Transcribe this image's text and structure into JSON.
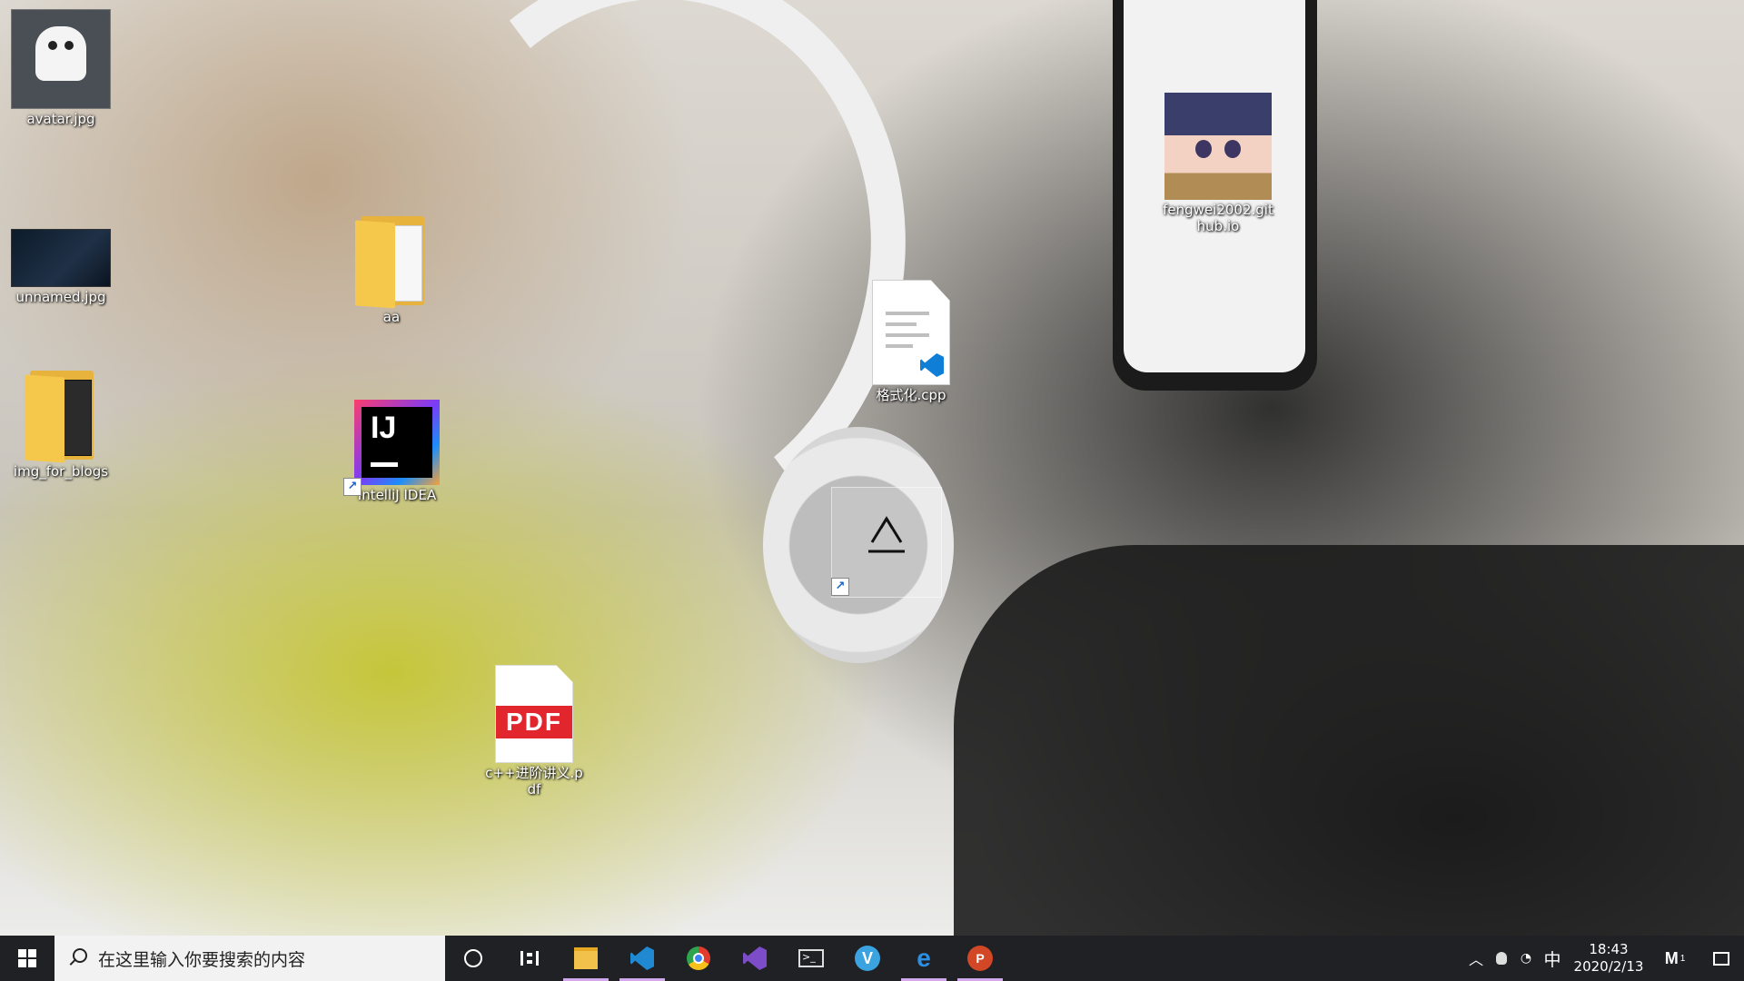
{
  "desktop": {
    "icons": [
      {
        "label": "avatar.jpg",
        "icon": "image-thumbnail-icon"
      },
      {
        "label": "unnamed.jpg",
        "icon": "image-thumbnail-icon"
      },
      {
        "label": "img_for_blogs",
        "icon": "folder-icon"
      },
      {
        "label": "aa",
        "icon": "folder-icon"
      },
      {
        "label": "IntelliJ IDEA",
        "icon": "intellij-idea-icon"
      },
      {
        "label": "格式化.cpp",
        "icon": "vscode-file-icon"
      },
      {
        "label": "",
        "icon": "recycle-bin-icon"
      },
      {
        "label": "c++进阶讲义.pdf",
        "icon": "pdf-file-icon"
      },
      {
        "label": "fengwei2002.github.io",
        "icon": "image-thumbnail-icon"
      }
    ],
    "ij_text": "IJ",
    "pdf_text": "PDF"
  },
  "taskbar": {
    "search_placeholder": "在这里输入你要搜索的内容",
    "apps": [
      {
        "name": "file-explorer",
        "active": true
      },
      {
        "name": "visual-studio-code",
        "active": true
      },
      {
        "name": "chrome",
        "active": false
      },
      {
        "name": "visual-studio",
        "active": false
      },
      {
        "name": "terminal",
        "active": false
      },
      {
        "name": "v-app",
        "active": false
      },
      {
        "name": "edge",
        "active": true
      },
      {
        "name": "powerpoint",
        "active": true
      }
    ],
    "tray": {
      "ime": "中",
      "time": "18:43",
      "date": "2020/2/13",
      "notification_count": "1"
    }
  }
}
